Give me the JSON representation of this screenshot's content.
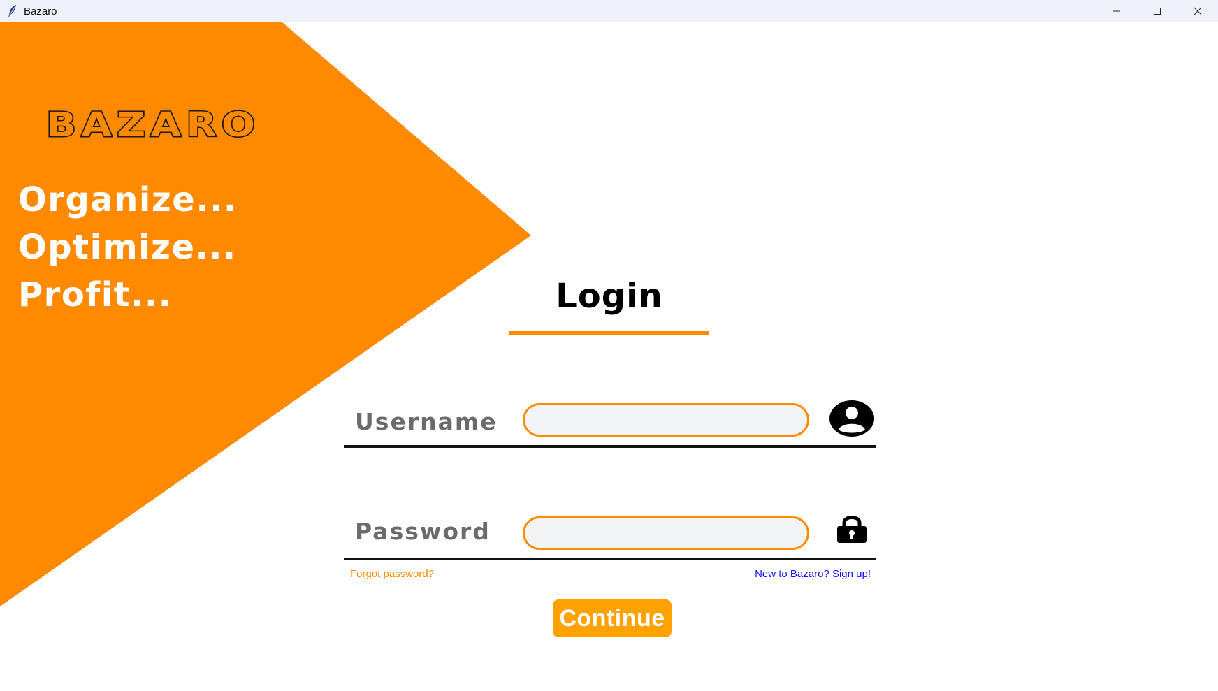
{
  "window": {
    "title": "Bazaro",
    "app_icon": "feather-icon",
    "controls": [
      "minimize-icon",
      "maximize-icon",
      "close-icon"
    ]
  },
  "hero": {
    "brand": "BAZARO",
    "taglines": [
      "Organize...",
      "Optimize...",
      "Profit..."
    ],
    "accent_color": "#ff8a00"
  },
  "login": {
    "title": "Login",
    "username": {
      "label": "Username",
      "value": "",
      "icon": "user-circle-icon"
    },
    "password": {
      "label": "Password",
      "value": "",
      "icon": "lock-icon"
    },
    "forgot_link": "Forgot password?",
    "signup_link": "New to Bazaro? Sign up!",
    "continue_label": "Continue"
  },
  "colors": {
    "orange": "#ff8a00",
    "button": "#ffa200",
    "link_blue": "#1010ff",
    "label_gray": "#6b6b6b"
  }
}
